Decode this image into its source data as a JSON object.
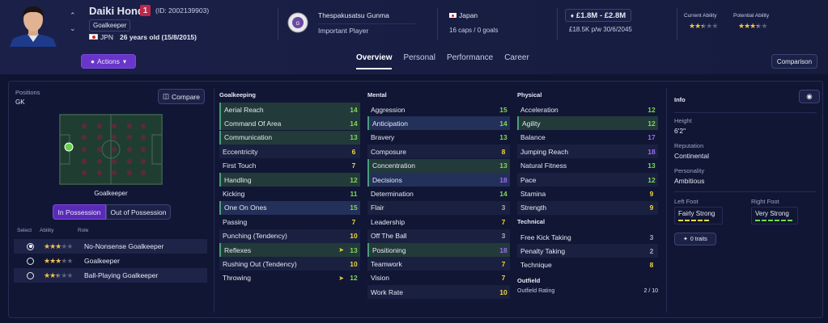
{
  "player": {
    "name": "Daiki Honda",
    "squad_number": "1",
    "id_text": "(ID: 2002139903)",
    "position": "Goalkeeper",
    "nationality_code": "JPN",
    "age_text": "26 years old (15/8/2015)"
  },
  "club": {
    "name": "Thespakusatsu Gunma",
    "status": "Important Player"
  },
  "nation": {
    "name": "Japan",
    "caps_text": "16 caps / 0 goals"
  },
  "value": {
    "range": "£1.8M - £2.8M",
    "wage_text": "£18.5K p/w 30/6/2045"
  },
  "ability": {
    "current_label": "Current Ability",
    "potential_label": "Potential Ability",
    "current_stars": 2.5,
    "potential_stars": 3.5
  },
  "actions_label": "Actions",
  "tabs": [
    {
      "label": "Overview",
      "active": true
    },
    {
      "label": "Personal",
      "active": false
    },
    {
      "label": "Performance",
      "active": false
    },
    {
      "label": "Career",
      "active": false
    }
  ],
  "comparison_label": "Comparison",
  "positions": {
    "title": "Positions",
    "value": "GK",
    "compare_label": "Compare",
    "pitch_label": "Goalkeeper",
    "in_possession": "In Possession",
    "out_possession": "Out of Possession"
  },
  "roles": {
    "headers": [
      "Select",
      "Ability",
      "Role"
    ],
    "items": [
      {
        "name": "No-Nonsense Goalkeeper",
        "stars": 3,
        "selected": true
      },
      {
        "name": "Goalkeeper",
        "stars": 3,
        "selected": false
      },
      {
        "name": "Ball-Playing Goalkeeper",
        "stars": 2.5,
        "selected": false
      }
    ]
  },
  "goalkeeping": {
    "title": "Goalkeeping",
    "attrs": [
      {
        "name": "Aerial Reach",
        "value": "14",
        "color": "green",
        "style": "hlg"
      },
      {
        "name": "Command Of Area",
        "value": "14",
        "color": "green",
        "style": "hlg"
      },
      {
        "name": "Communication",
        "value": "13",
        "color": "green",
        "style": "hlg"
      },
      {
        "name": "Eccentricity",
        "value": "6",
        "color": "yellow",
        "style": "alt"
      },
      {
        "name": "First Touch",
        "value": "7",
        "color": "yellow",
        "style": ""
      },
      {
        "name": "Handling",
        "value": "12",
        "color": "green",
        "style": "hlg"
      },
      {
        "name": "Kicking",
        "value": "11",
        "color": "green",
        "style": ""
      },
      {
        "name": "One On Ones",
        "value": "15",
        "color": "green",
        "style": "hl"
      },
      {
        "name": "Passing",
        "value": "7",
        "color": "yellow",
        "style": ""
      },
      {
        "name": "Punching (Tendency)",
        "value": "10",
        "color": "yellow",
        "style": "alt"
      },
      {
        "name": "Reflexes",
        "value": "13",
        "color": "green",
        "style": "hlg",
        "arrow": true
      },
      {
        "name": "Rushing Out (Tendency)",
        "value": "10",
        "color": "yellow",
        "style": "alt"
      },
      {
        "name": "Throwing",
        "value": "12",
        "color": "green",
        "style": "",
        "arrow": true
      }
    ]
  },
  "mental": {
    "title": "Mental",
    "attrs": [
      {
        "name": "Aggression",
        "value": "15",
        "color": "green",
        "style": ""
      },
      {
        "name": "Anticipation",
        "value": "14",
        "color": "green",
        "style": "hl"
      },
      {
        "name": "Bravery",
        "value": "13",
        "color": "green",
        "style": ""
      },
      {
        "name": "Composure",
        "value": "8",
        "color": "yellow",
        "style": "alt"
      },
      {
        "name": "Concentration",
        "value": "13",
        "color": "green",
        "style": "hlg"
      },
      {
        "name": "Decisions",
        "value": "18",
        "color": "purple",
        "style": "hl"
      },
      {
        "name": "Determination",
        "value": "14",
        "color": "green",
        "style": ""
      },
      {
        "name": "Flair",
        "value": "3",
        "color": "grey",
        "style": "alt"
      },
      {
        "name": "Leadership",
        "value": "7",
        "color": "yellow",
        "style": ""
      },
      {
        "name": "Off The Ball",
        "value": "3",
        "color": "grey",
        "style": "alt"
      },
      {
        "name": "Positioning",
        "value": "18",
        "color": "purple",
        "style": "hlg"
      },
      {
        "name": "Teamwork",
        "value": "7",
        "color": "yellow",
        "style": "alt"
      },
      {
        "name": "Vision",
        "value": "7",
        "color": "yellow",
        "style": ""
      },
      {
        "name": "Work Rate",
        "value": "10",
        "color": "yellow",
        "style": "alt"
      }
    ]
  },
  "physical": {
    "title": "Physical",
    "attrs": [
      {
        "name": "Acceleration",
        "value": "12",
        "color": "green",
        "style": ""
      },
      {
        "name": "Agility",
        "value": "12",
        "color": "green",
        "style": "hlg"
      },
      {
        "name": "Balance",
        "value": "17",
        "color": "purple",
        "style": ""
      },
      {
        "name": "Jumping Reach",
        "value": "18",
        "color": "purple",
        "style": "alt"
      },
      {
        "name": "Natural Fitness",
        "value": "13",
        "color": "green",
        "style": ""
      },
      {
        "name": "Pace",
        "value": "12",
        "color": "green",
        "style": "alt"
      },
      {
        "name": "Stamina",
        "value": "9",
        "color": "yellow",
        "style": ""
      },
      {
        "name": "Strength",
        "value": "9",
        "color": "yellow",
        "style": "alt"
      }
    ]
  },
  "technical": {
    "title": "Technical",
    "attrs": [
      {
        "name": "Free Kick Taking",
        "value": "3",
        "color": "grey",
        "style": ""
      },
      {
        "name": "Penalty Taking",
        "value": "2",
        "color": "grey",
        "style": "alt"
      },
      {
        "name": "Technique",
        "value": "8",
        "color": "yellow",
        "style": ""
      }
    ]
  },
  "outfield": {
    "title": "Outfield",
    "rating_label": "Outfield Rating",
    "rating_value": "2 / 10"
  },
  "info": {
    "title": "Info",
    "height_label": "Height",
    "height": "6'2\"",
    "reputation_label": "Reputation",
    "reputation": "Continental",
    "personality_label": "Personality",
    "personality": "Ambitious",
    "left_foot_label": "Left Foot",
    "left_foot": "Fairly Strong",
    "right_foot_label": "Right Foot",
    "right_foot": "Very Strong",
    "traits": "0 traits"
  }
}
